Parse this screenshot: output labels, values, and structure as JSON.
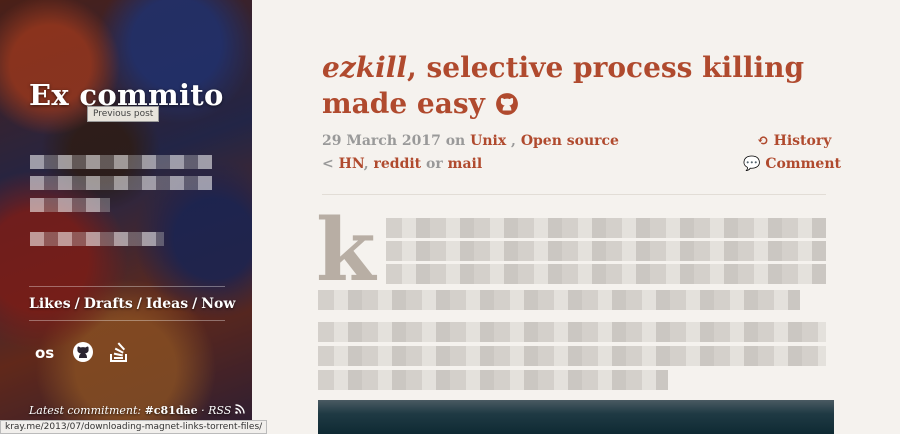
{
  "sidebar": {
    "site_title": "Ex commito",
    "tooltip": "Previous post",
    "nav": [
      "Likes",
      "Drafts",
      "Ideas",
      "Now"
    ],
    "social_icons": [
      "lastfm-icon",
      "github-icon",
      "stackoverflow-icon"
    ],
    "commit_label": "Latest commitment:",
    "commit_hash": "#c81dae",
    "rss_label": "RSS"
  },
  "post": {
    "title_em": "ezkill",
    "title_rest": ", selective process killing made easy",
    "date": "29 March 2017",
    "on": "on",
    "tags": [
      "Unix",
      "Open source"
    ],
    "history": "History",
    "share_hn": "HN",
    "share_reddit": "reddit",
    "share_or": "or",
    "share_mail": "mail",
    "comment": "Comment",
    "dropcap": "k"
  },
  "status_bar": {
    "url": "kray.me/2013/07/downloading-magnet-links-torrent-files/"
  },
  "colors": {
    "accent": "#b04a2e",
    "muted": "#999999",
    "background": "#f5f2ee"
  }
}
